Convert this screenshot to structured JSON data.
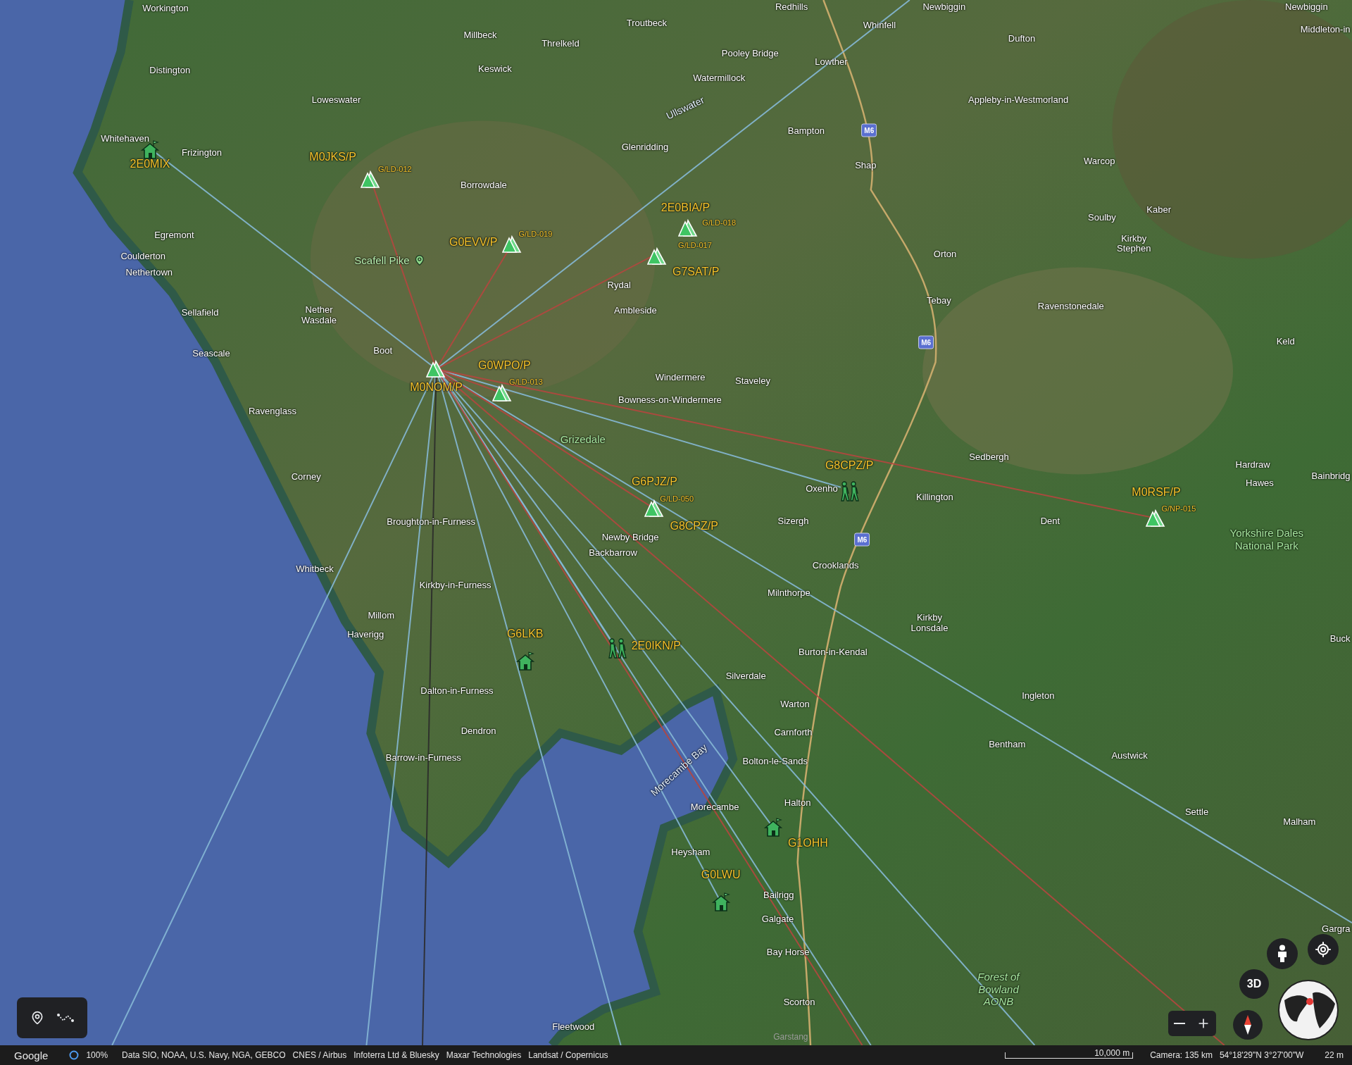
{
  "map": {
    "places": [
      {
        "text": "Workington",
        "kind": "town"
      },
      {
        "text": "Redhills",
        "kind": "town"
      },
      {
        "text": "Newbiggin",
        "kind": "town"
      },
      {
        "text": "Newbiggin",
        "kind": "town"
      },
      {
        "text": "Troutbeck",
        "kind": "town"
      },
      {
        "text": "Whinfell",
        "kind": "town"
      },
      {
        "text": "Middleton-in",
        "kind": "town"
      },
      {
        "text": "Millbeck",
        "kind": "town"
      },
      {
        "text": "Dufton",
        "kind": "town"
      },
      {
        "text": "Threlkeld",
        "kind": "town"
      },
      {
        "text": "Pooley Bridge",
        "kind": "town"
      },
      {
        "text": "Lowther",
        "kind": "town"
      },
      {
        "text": "Distington",
        "kind": "town"
      },
      {
        "text": "Keswick",
        "kind": "town"
      },
      {
        "text": "Watermillock",
        "kind": "town"
      },
      {
        "text": "Loweswater",
        "kind": "town"
      },
      {
        "text": "Appleby-in-Westmorland",
        "kind": "town"
      },
      {
        "text": "Ullswater",
        "kind": "water"
      },
      {
        "text": "Bampton",
        "kind": "town"
      },
      {
        "text": "Whitehaven",
        "kind": "town"
      },
      {
        "text": "Frizington",
        "kind": "town"
      },
      {
        "text": "Glenridding",
        "kind": "town"
      },
      {
        "text": "Shap",
        "kind": "town"
      },
      {
        "text": "Warcop",
        "kind": "town"
      },
      {
        "text": "Borrowdale",
        "kind": "town"
      },
      {
        "text": "Soulby",
        "kind": "town"
      },
      {
        "text": "Kaber",
        "kind": "town"
      },
      {
        "text": "Egremont",
        "kind": "town"
      },
      {
        "text": "Coulderton",
        "kind": "town"
      },
      {
        "text": "Scafell Pike",
        "kind": "peak"
      },
      {
        "text": "Orton",
        "kind": "town"
      },
      {
        "text": "Kirkby Stephen",
        "kind": "town"
      },
      {
        "text": "Nethertown",
        "kind": "town"
      },
      {
        "text": "Rydal",
        "kind": "town"
      },
      {
        "text": "Sellafield",
        "kind": "town"
      },
      {
        "text": "Nether Wasdale",
        "kind": "town"
      },
      {
        "text": "Ambleside",
        "kind": "town"
      },
      {
        "text": "Tebay",
        "kind": "town"
      },
      {
        "text": "Ravenstonedale",
        "kind": "town"
      },
      {
        "text": "Keld",
        "kind": "town"
      },
      {
        "text": "Seascale",
        "kind": "town"
      },
      {
        "text": "Boot",
        "kind": "town"
      },
      {
        "text": "Windermere",
        "kind": "town"
      },
      {
        "text": "Staveley",
        "kind": "town"
      },
      {
        "text": "Bowness-on-Windermere",
        "kind": "town"
      },
      {
        "text": "Ravenglass",
        "kind": "town"
      },
      {
        "text": "Grizedale",
        "kind": "park"
      },
      {
        "text": "Sedbergh",
        "kind": "town"
      },
      {
        "text": "Hardraw",
        "kind": "town"
      },
      {
        "text": "Corney",
        "kind": "town"
      },
      {
        "text": "Hawes",
        "kind": "town"
      },
      {
        "text": "Bainbridg",
        "kind": "town"
      },
      {
        "text": "Oxenho",
        "kind": "town"
      },
      {
        "text": "Killington",
        "kind": "town"
      },
      {
        "text": "Broughton-in-Furness",
        "kind": "town"
      },
      {
        "text": "Newby Bridge",
        "kind": "town"
      },
      {
        "text": "Sizergh",
        "kind": "town"
      },
      {
        "text": "Dent",
        "kind": "town"
      },
      {
        "text": "Yorkshire Dales National Park",
        "kind": "park"
      },
      {
        "text": "Backbarrow",
        "kind": "town"
      },
      {
        "text": "Whitbeck",
        "kind": "town"
      },
      {
        "text": "Crooklands",
        "kind": "town"
      },
      {
        "text": "Kirkby-in-Furness",
        "kind": "town"
      },
      {
        "text": "Milnthorpe",
        "kind": "town"
      },
      {
        "text": "Millom",
        "kind": "town"
      },
      {
        "text": "Haverigg",
        "kind": "town"
      },
      {
        "text": "Kirkby Lonsdale",
        "kind": "town"
      },
      {
        "text": "Buck",
        "kind": "town"
      },
      {
        "text": "Burton-in-Kendal",
        "kind": "town"
      },
      {
        "text": "Silverdale",
        "kind": "town"
      },
      {
        "text": "Dalton-in-Furness",
        "kind": "town"
      },
      {
        "text": "Warton",
        "kind": "town"
      },
      {
        "text": "Ingleton",
        "kind": "town"
      },
      {
        "text": "Dendron",
        "kind": "town"
      },
      {
        "text": "Carnforth",
        "kind": "town"
      },
      {
        "text": "Bentham",
        "kind": "town"
      },
      {
        "text": "Barrow-in-Furness",
        "kind": "town"
      },
      {
        "text": "Bolton-le-Sands",
        "kind": "town"
      },
      {
        "text": "Austwick",
        "kind": "town"
      },
      {
        "text": "Morecambe Bay",
        "kind": "water"
      },
      {
        "text": "Morecambe",
        "kind": "town"
      },
      {
        "text": "Halton",
        "kind": "town"
      },
      {
        "text": "Settle",
        "kind": "town"
      },
      {
        "text": "Malham",
        "kind": "town"
      },
      {
        "text": "Heysham",
        "kind": "town"
      },
      {
        "text": "Bailrigg",
        "kind": "town"
      },
      {
        "text": "Galgate",
        "kind": "town"
      },
      {
        "text": "Gargra",
        "kind": "town"
      },
      {
        "text": "Bay Horse",
        "kind": "town"
      },
      {
        "text": "Scorton",
        "kind": "town"
      },
      {
        "text": "Forest of Bowland AONB",
        "kind": "area"
      },
      {
        "text": "Fleetwood",
        "kind": "town"
      },
      {
        "text": "Garstang",
        "kind": "faint"
      }
    ],
    "road_shields": [
      "M6",
      "M6",
      "M6"
    ],
    "stations": [
      {
        "callsign": "2E0MIX",
        "kind": "home"
      },
      {
        "callsign": "M0JKS/P",
        "kind": "summit",
        "summit_ref": "G/LD-012"
      },
      {
        "callsign": "2E0BIA/P",
        "kind": "summit",
        "summit_ref": "G/LD-018"
      },
      {
        "callsign": "G0EVV/P",
        "kind": "summit",
        "summit_ref": "G/LD-019"
      },
      {
        "callsign": "G7SAT/P",
        "kind": "summit",
        "summit_ref": "G/LD-017"
      },
      {
        "callsign": "G0WPO/P",
        "kind": "summit",
        "summit_ref": "G/LD-013"
      },
      {
        "callsign": "M0NOM/P",
        "kind": "summit"
      },
      {
        "callsign": "G8CPZ/P",
        "kind": "hiker"
      },
      {
        "callsign": "G6PJZ/P",
        "kind": "summit",
        "summit_ref": "G/LD-050"
      },
      {
        "callsign": "M0RSF/P",
        "kind": "summit",
        "summit_ref": "G/NP-015"
      },
      {
        "callsign": "G8CPZ/P",
        "kind": "none"
      },
      {
        "callsign": "G6LKB",
        "kind": "home"
      },
      {
        "callsign": "2E0IKN/P",
        "kind": "hiker"
      },
      {
        "callsign": "G1OHH",
        "kind": "home"
      },
      {
        "callsign": "G0LWU",
        "kind": "home"
      }
    ]
  },
  "controls": {
    "view_3d": "3D"
  },
  "status_bar": {
    "logo": "Google",
    "zoom": "100%",
    "attributions": [
      "Data SIO, NOAA, U.S. Navy, NGA, GEBCO",
      "CNES / Airbus",
      "Infoterra Ltd & Bluesky",
      "Maxar Technologies",
      "Landsat / Copernicus"
    ],
    "scale": "10,000 m",
    "camera": "Camera: 135 km",
    "coordinates": "54°18'29\"N 3°27'00\"W",
    "altitude": "22 m"
  }
}
